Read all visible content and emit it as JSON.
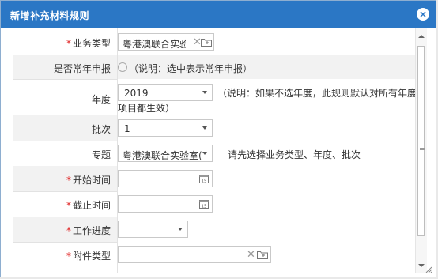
{
  "dialog": {
    "title": "新增补充材料规则",
    "close_label": "×"
  },
  "form": {
    "business_type": {
      "label": "业务类型",
      "required": "*",
      "value": "粤港澳联合实验室"
    },
    "perennial": {
      "label": "是否常年申报",
      "hint": "（说明：选中表示常年申报）"
    },
    "year": {
      "label": "年度",
      "value": "2019",
      "hint_line1": "（说明：如果不选年度，此规则默认对所有年度",
      "hint_line2": "项目都生效）"
    },
    "batch": {
      "label": "批次",
      "value": "1"
    },
    "topic": {
      "label": "专题",
      "value": "粤港澳联合实验室(",
      "hint": "请先选择业务类型、年度、批次"
    },
    "start_time": {
      "label": "开始时间",
      "required": "*",
      "value": ""
    },
    "end_time": {
      "label": "截止时间",
      "required": "*",
      "value": ""
    },
    "progress": {
      "label": "工作进度",
      "required": "*",
      "value": ""
    },
    "attachment_type": {
      "label": "附件类型",
      "required": "*",
      "value": ""
    }
  },
  "icons": {
    "close": "close-icon",
    "calendar": "calendar-icon",
    "clear": "clear-icon",
    "folder": "folder-icon"
  },
  "colors": {
    "titlebar": "#2b77c5",
    "required": "#e02020",
    "row_alt": "#f2f2f2"
  }
}
